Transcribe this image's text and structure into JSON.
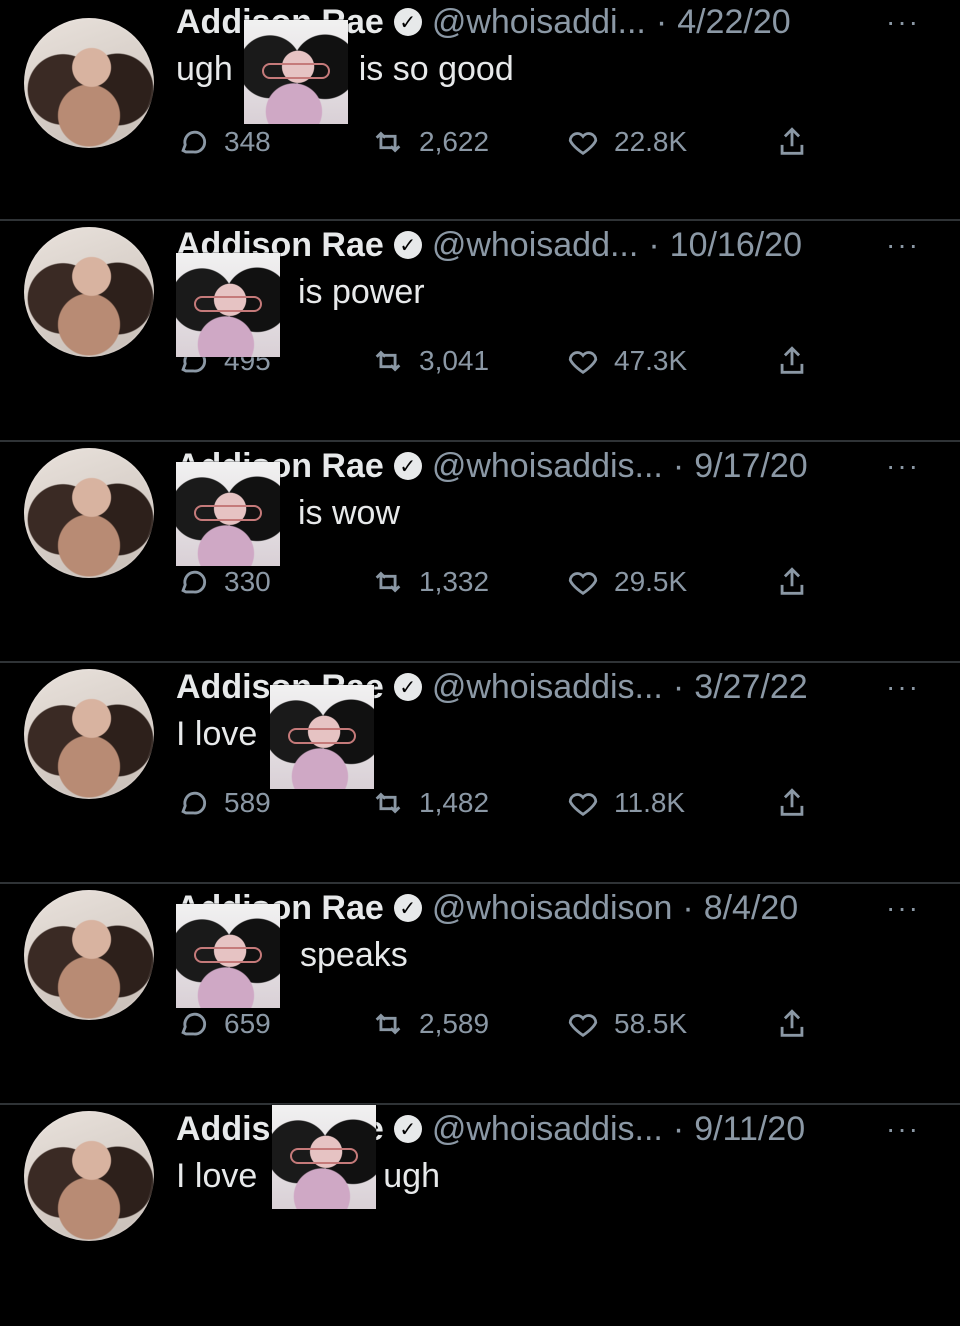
{
  "tweets": [
    {
      "name": "Addison Rae",
      "handle": "@whoisaddi...",
      "date": "4/22/20",
      "text_before": "ugh",
      "text_after": "is so good",
      "replies": "348",
      "retweets": "2,622",
      "likes": "22.8K"
    },
    {
      "name": "Addison Rae",
      "handle": "@whoisadd...",
      "date": "10/16/20",
      "text_before": "",
      "text_after": "is power",
      "replies": "495",
      "retweets": "3,041",
      "likes": "47.3K"
    },
    {
      "name": "Addison Rae",
      "handle": "@whoisaddis...",
      "date": "9/17/20",
      "text_before": "",
      "text_after": "is wow",
      "replies": "330",
      "retweets": "1,332",
      "likes": "29.5K"
    },
    {
      "name": "Addison Rae",
      "handle": "@whoisaddis...",
      "date": "3/27/22",
      "text_before": "I love",
      "text_after": "",
      "replies": "589",
      "retweets": "1,482",
      "likes": "11.8K"
    },
    {
      "name": "Addison Rae",
      "handle": "@whoisaddison",
      "date": "8/4/20",
      "text_before": "",
      "text_after": "speaks",
      "replies": "659",
      "retweets": "2,589",
      "likes": "58.5K"
    },
    {
      "name": "Addison Rae",
      "handle": "@whoisaddis...",
      "date": "9/11/20",
      "text_before": "I love",
      "text_after": "ugh",
      "replies": "",
      "retweets": "",
      "likes": ""
    }
  ],
  "ui": {
    "separator": "·",
    "more": "···",
    "verified_glyph": "✓",
    "icons": {
      "reply": "reply-icon",
      "retweet": "retweet-icon",
      "like": "heart-icon",
      "share": "share-icon",
      "more": "more-icon",
      "verified": "verified-icon"
    }
  }
}
